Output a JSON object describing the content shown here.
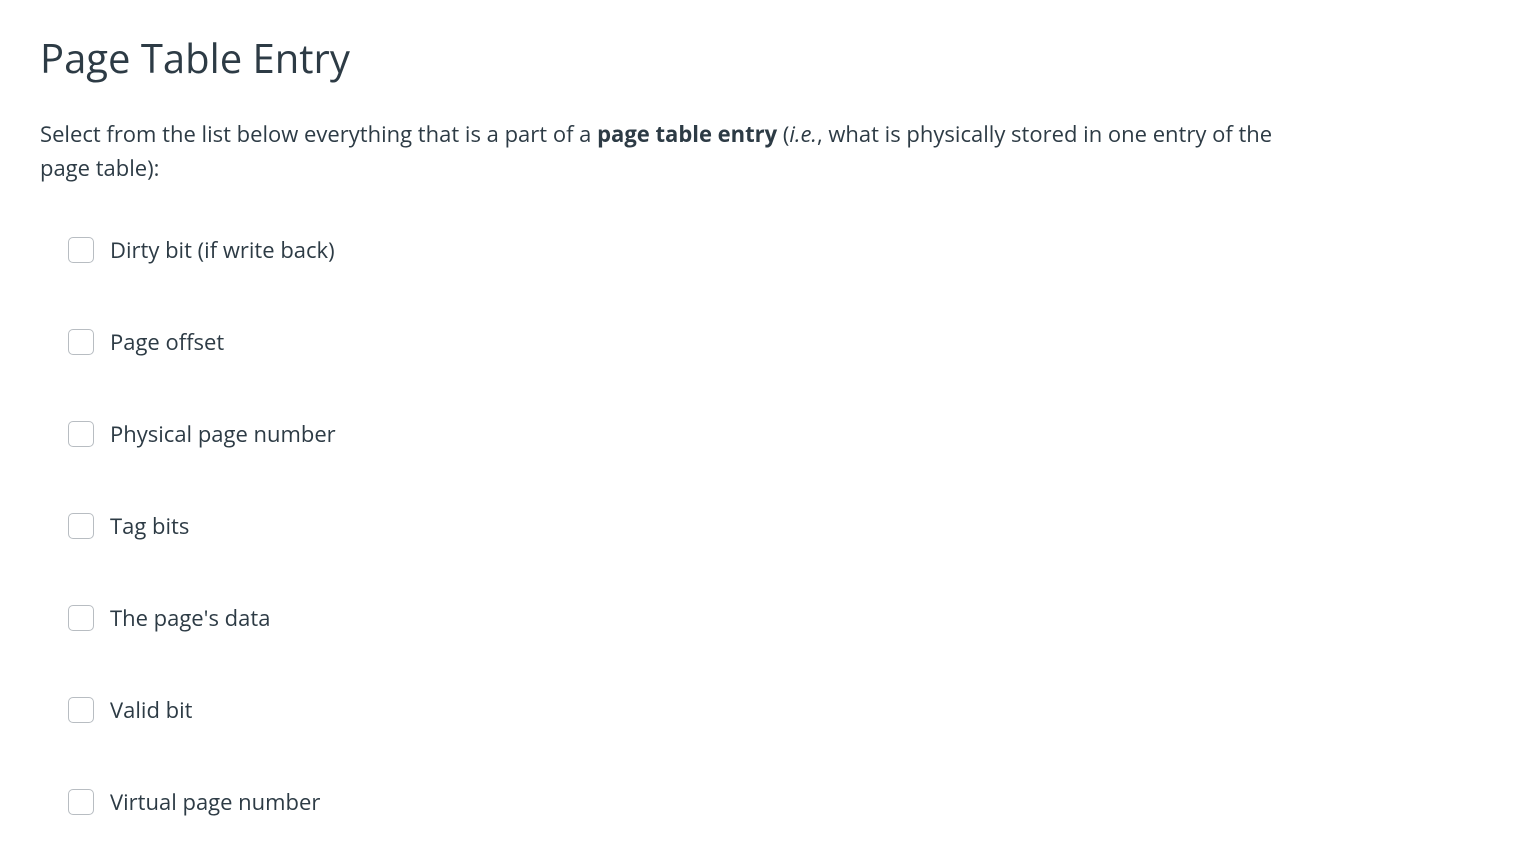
{
  "title": "Page Table Entry",
  "prompt": {
    "pre": "Select from the list below everything that is a part of a ",
    "bold": "page table entry",
    "paren_open": " (",
    "ital": "i.e.",
    "post": ", what is physically stored in one entry of the page table):"
  },
  "options": [
    {
      "label": "Dirty bit (if write back)"
    },
    {
      "label": "Page offset"
    },
    {
      "label": "Physical page number"
    },
    {
      "label": "Tag bits"
    },
    {
      "label": "The page's data"
    },
    {
      "label": "Valid bit"
    },
    {
      "label": "Virtual page number"
    }
  ]
}
